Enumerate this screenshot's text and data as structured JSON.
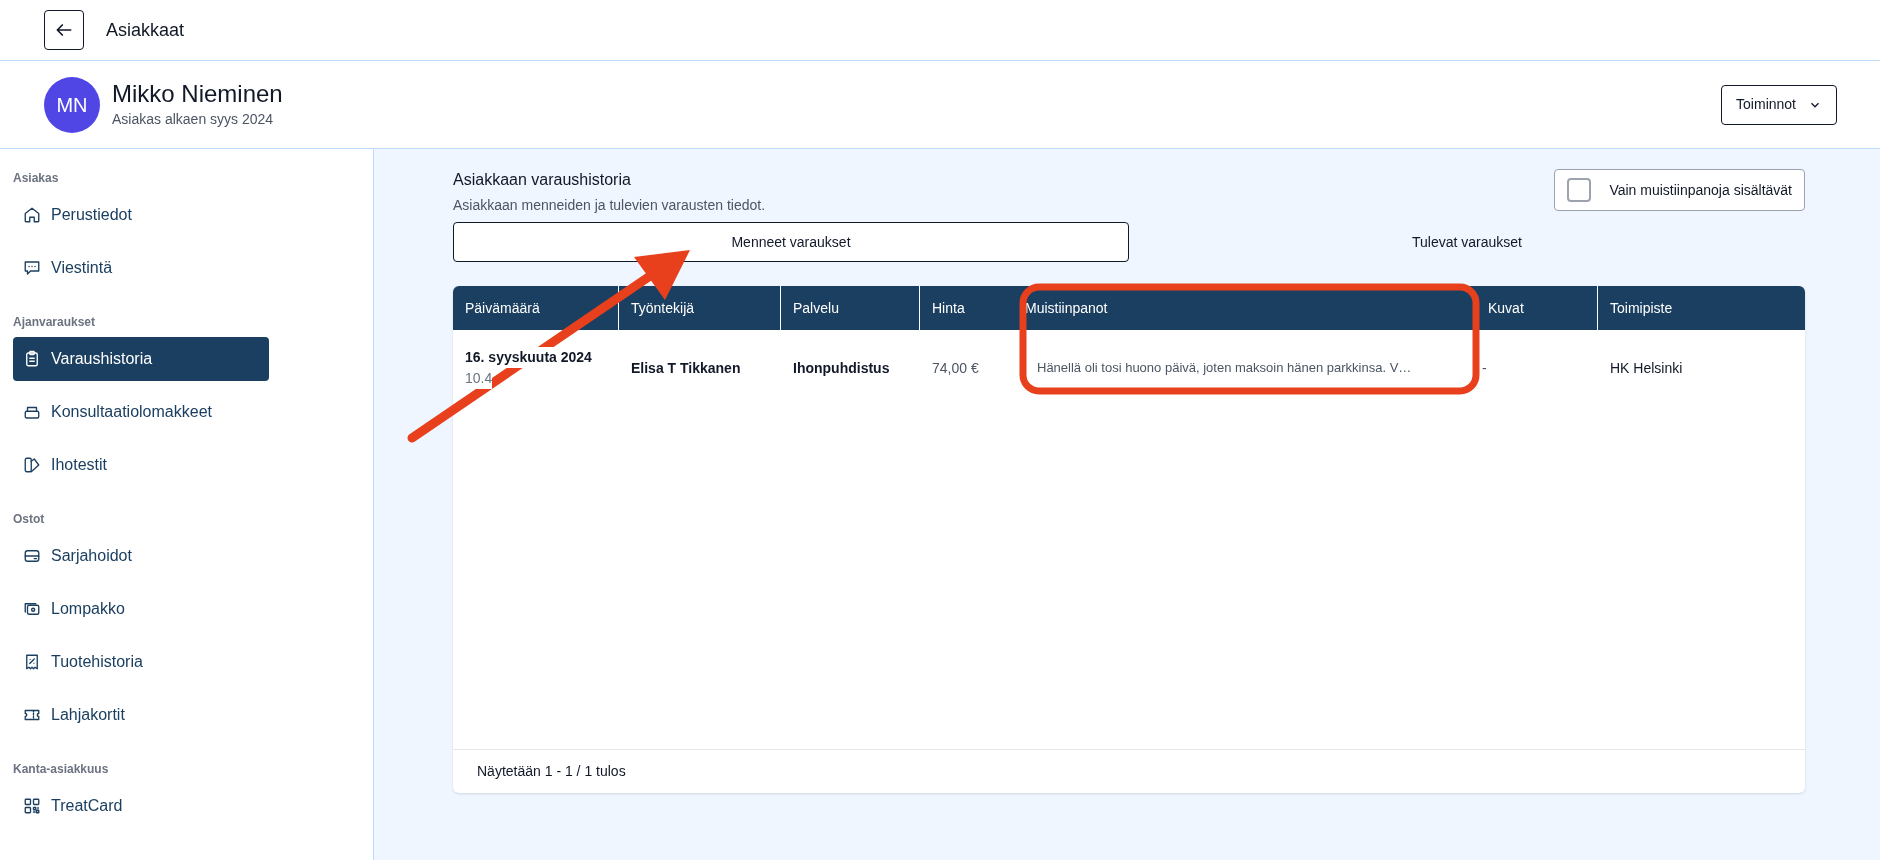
{
  "top_bar": {
    "title": "Asiakkaat"
  },
  "customer": {
    "initials": "MN",
    "name": "Mikko Nieminen",
    "subtitle": "Asiakas alkaen syys 2024",
    "actions_button": "Toiminnot"
  },
  "sidebar": {
    "sections": [
      {
        "title": "Asiakas",
        "items": [
          {
            "label": "Perustiedot",
            "selected": false
          },
          {
            "label": "Viestintä",
            "selected": false
          }
        ]
      },
      {
        "title": "Ajanvaraukset",
        "items": [
          {
            "label": "Varaushistoria",
            "selected": true
          },
          {
            "label": "Konsultaatiolomakkeet",
            "selected": false
          },
          {
            "label": "Ihotestit",
            "selected": false
          }
        ]
      },
      {
        "title": "Ostot",
        "items": [
          {
            "label": "Sarjahoidot",
            "selected": false
          },
          {
            "label": "Lompakko",
            "selected": false
          },
          {
            "label": "Tuotehistoria",
            "selected": false
          },
          {
            "label": "Lahjakortit",
            "selected": false
          }
        ]
      },
      {
        "title": "Kanta-asiakkuus",
        "items": [
          {
            "label": "TreatCard",
            "selected": false
          }
        ]
      }
    ]
  },
  "history": {
    "title": "Asiakkaan varaushistoria",
    "subtitle": "Asiakkaan menneiden ja tulevien varausten tiedot.",
    "filter": {
      "label": "Vain muistiinpanoja sisältävät",
      "checked": false
    },
    "tabs": [
      {
        "label": "Menneet varaukset",
        "selected": true
      },
      {
        "label": "Tulevat varaukset",
        "selected": false
      }
    ],
    "table": {
      "columns": [
        "Päivämäärä",
        "Työntekijä",
        "Palvelu",
        "Hinta",
        "Muistiinpanot",
        "Kuvat",
        "Toimipiste"
      ],
      "rows": [
        {
          "date": "16. syyskuuta 2024",
          "time": "10.4",
          "employee": "Elisa T Tikkanen",
          "service": "Ihonpuhdistus",
          "price": "74,00 €",
          "notes": "Hänellä oli tosi huono päivä, joten maksoin hänen parkkinsa. V…",
          "images": "-",
          "location": "HK Helsinki"
        }
      ]
    },
    "footer": "Näytetään 1 - 1 / 1 tulos"
  }
}
